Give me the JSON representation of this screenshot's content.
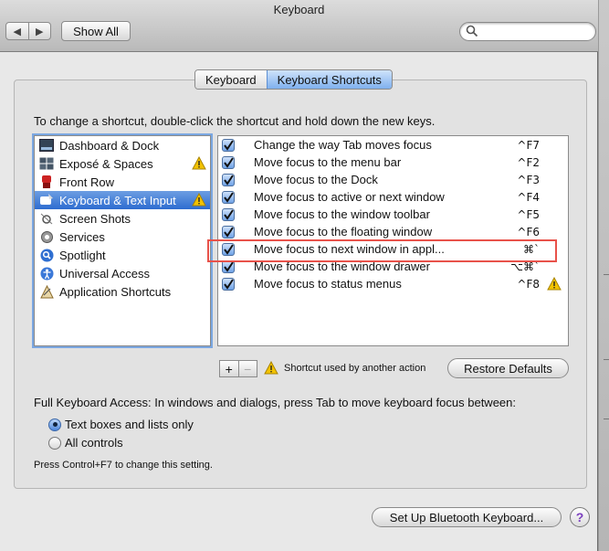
{
  "window": {
    "title": "Keyboard",
    "show_all": "Show All",
    "search": {
      "placeholder": "",
      "value": ""
    }
  },
  "tabs": [
    {
      "label": "Keyboard",
      "selected": false
    },
    {
      "label": "Keyboard Shortcuts",
      "selected": true
    }
  ],
  "instruction": "To change a shortcut, double-click the shortcut and hold down the new keys.",
  "categories": [
    {
      "label": "Dashboard & Dock",
      "icon": "dashboard-dock-icon",
      "warning": false,
      "selected": false
    },
    {
      "label": "Exposé & Spaces",
      "icon": "expose-spaces-icon",
      "warning": true,
      "selected": false
    },
    {
      "label": "Front Row",
      "icon": "front-row-icon",
      "warning": false,
      "selected": false
    },
    {
      "label": "Keyboard & Text Input",
      "icon": "keyboard-text-input-icon",
      "warning": true,
      "selected": true
    },
    {
      "label": "Screen Shots",
      "icon": "screen-shots-icon",
      "warning": false,
      "selected": false
    },
    {
      "label": "Services",
      "icon": "services-gear-icon",
      "warning": false,
      "selected": false
    },
    {
      "label": "Spotlight",
      "icon": "spotlight-icon",
      "warning": false,
      "selected": false
    },
    {
      "label": "Universal Access",
      "icon": "universal-access-icon",
      "warning": false,
      "selected": false
    },
    {
      "label": "Application Shortcuts",
      "icon": "application-shortcuts-icon",
      "warning": false,
      "selected": false
    }
  ],
  "shortcuts": [
    {
      "label": "Change the way Tab moves focus",
      "key": "^F7",
      "checked": true,
      "warning": false
    },
    {
      "label": "Move focus to the menu bar",
      "key": "^F2",
      "checked": true,
      "warning": false
    },
    {
      "label": "Move focus to the Dock",
      "key": "^F3",
      "checked": true,
      "warning": false
    },
    {
      "label": "Move focus to active or next window",
      "key": "^F4",
      "checked": true,
      "warning": false
    },
    {
      "label": "Move focus to the window toolbar",
      "key": "^F5",
      "checked": true,
      "warning": false
    },
    {
      "label": "Move focus to the floating window",
      "key": "^F6",
      "checked": true,
      "warning": false
    },
    {
      "label": "Move focus to next window in appl...",
      "key": "⌘`",
      "checked": true,
      "warning": false,
      "highlighted": true
    },
    {
      "label": "Move focus to the window drawer",
      "key": "⌥⌘`",
      "checked": true,
      "warning": false
    },
    {
      "label": "Move focus to status menus",
      "key": "^F8",
      "checked": true,
      "warning": true
    }
  ],
  "list_controls": {
    "add": "+",
    "remove": "−",
    "legend": "Shortcut used by another action",
    "restore": "Restore Defaults"
  },
  "full_keyboard_access": {
    "label": "Full Keyboard Access: In windows and dialogs, press Tab to move keyboard focus between:",
    "options": [
      {
        "label": "Text boxes and lists only",
        "selected": true
      },
      {
        "label": "All controls",
        "selected": false
      }
    ],
    "note": "Press Control+F7 to change this setting."
  },
  "bluetooth_button": "Set Up Bluetooth Keyboard...",
  "help": "?",
  "colors": {
    "selection_blue": "#2d6cd0",
    "highlight_red": "#e8524a",
    "warning_yellow": "#f3c300",
    "help_purple": "#7b3fbf"
  }
}
